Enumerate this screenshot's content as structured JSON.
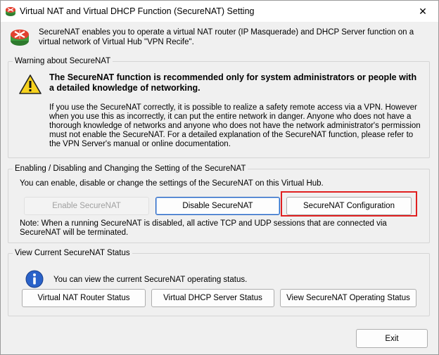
{
  "window": {
    "title": "Virtual NAT and Virtual DHCP Function (SecureNAT) Setting",
    "close_glyph": "✕"
  },
  "header": {
    "text": "SecureNAT enables you to operate a virtual NAT router (IP Masquerade) and DHCP Server function on a virtual network of Virtual Hub \"VPN Recife\"."
  },
  "warning": {
    "legend": "Warning about SecureNAT",
    "headline": "The SecureNAT function is recommended only for system administrators or people with a detailed knowledge of networking.",
    "body": "If you use the SecureNAT correctly, it is possible to realize a safety remote access via a VPN. However when you use this as incorrectly, it can put the entire network in danger. Anyone who does not have a thorough knowledge of networks and anyone who does not have the network administrator's permission must not enable the SecureNAT. For a detailed explanation of the SecureNAT function, please refer to the VPN Server's manual or online documentation."
  },
  "enable_section": {
    "legend": "Enabling / Disabling and Changing the Setting of the SecureNAT",
    "description": "You can enable, disable or change the settings of the SecureNAT on this Virtual Hub.",
    "enable_label": "Enable SecureNAT",
    "disable_label": "Disable SecureNAT",
    "config_label": "SecureNAT Configuration",
    "note": "Note: When a running SecureNAT is disabled, all active TCP and UDP sessions that are connected via SecureNAT will be terminated."
  },
  "status_section": {
    "legend": "View Current SecureNAT Status",
    "description": "You can view the current SecureNAT operating status.",
    "router_label": "Virtual NAT Router Status",
    "dhcp_label": "Virtual DHCP Server Status",
    "operating_label": "View SecureNAT Operating Status"
  },
  "footer": {
    "exit_label": "Exit"
  },
  "colors": {
    "highlight": "#e02020",
    "focus_border": "#1f5fbf",
    "warning_yellow": "#f7d21e",
    "info_blue": "#2a62c9"
  }
}
